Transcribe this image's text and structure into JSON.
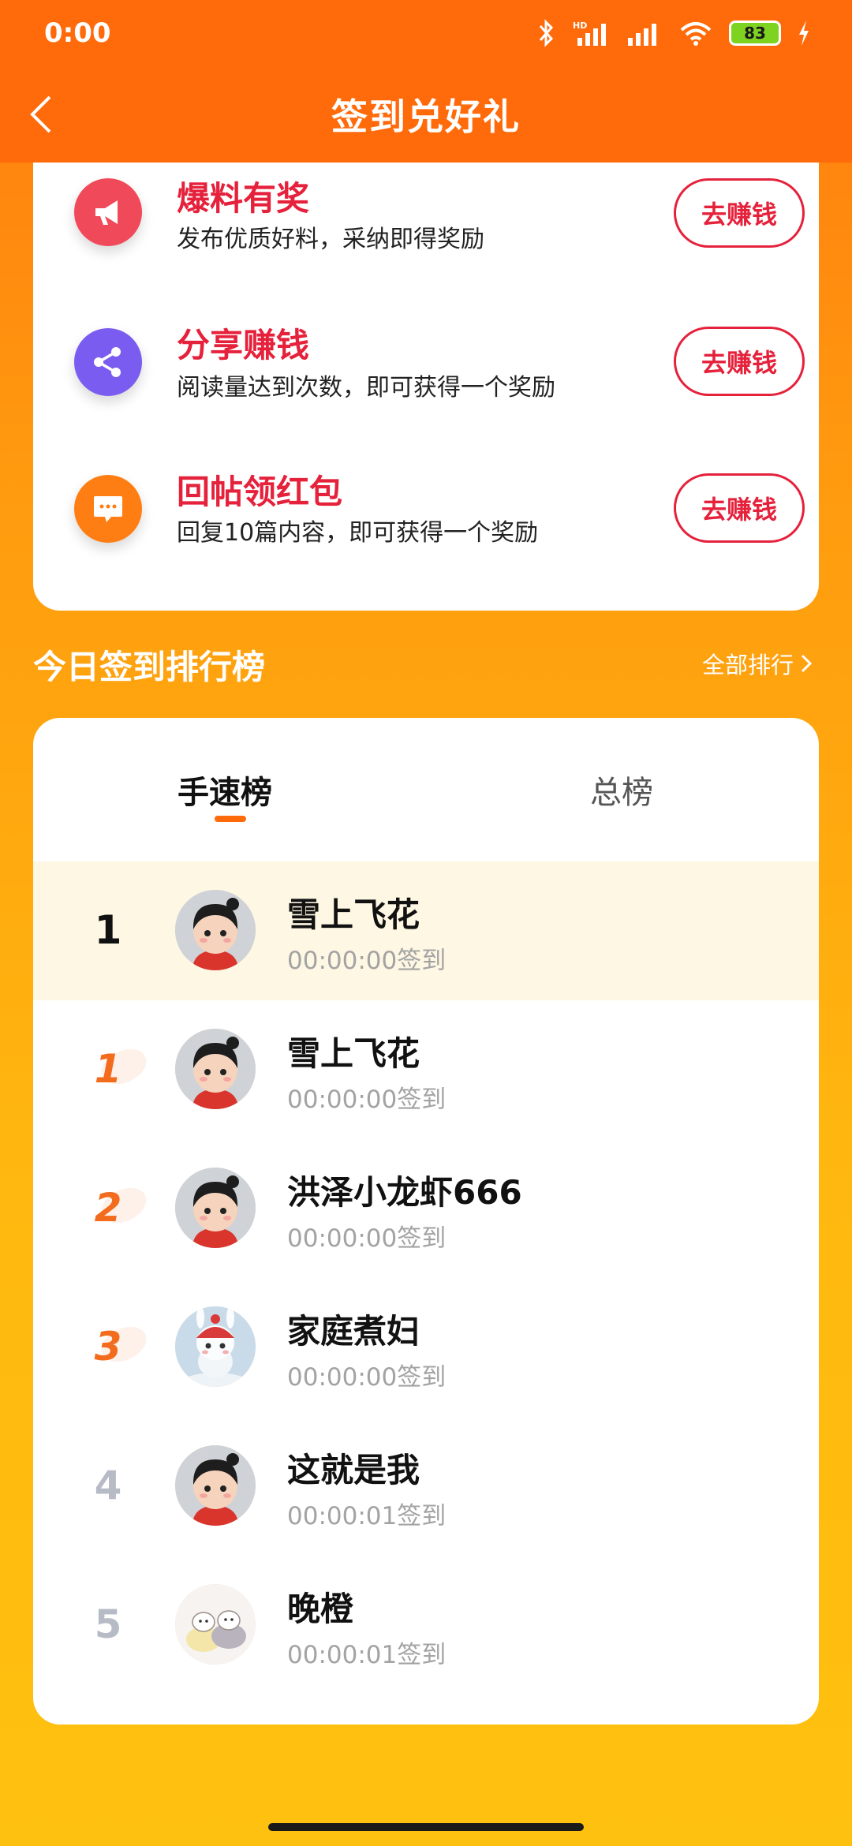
{
  "status_bar": {
    "time": "0:00",
    "battery": "83"
  },
  "header": {
    "title": "签到兑好礼"
  },
  "tasks": [
    {
      "title": "爆料有奖",
      "desc": "发布优质好料，采纳即得奖励",
      "button": "去赚钱",
      "icon": "megaphone-icon",
      "color": "#F04A5A"
    },
    {
      "title": "分享赚钱",
      "desc": "阅读量达到次数，即可获得一个奖励",
      "button": "去赚钱",
      "icon": "share-icon",
      "color": "#7B5CF0"
    },
    {
      "title": "回帖领红包",
      "desc": "回复10篇内容，即可获得一个奖励",
      "button": "去赚钱",
      "icon": "chat-bubble-icon",
      "color": "#FF7E14"
    }
  ],
  "ranking": {
    "section_title": "今日签到排行榜",
    "view_all": "全部排行",
    "tabs": [
      "手速榜",
      "总榜"
    ],
    "rows": [
      {
        "rank": "1",
        "name": "雪上飞花",
        "time": "00:00:00签到",
        "avatar": "cartoon-girl"
      },
      {
        "rank": "1",
        "name": "雪上飞花",
        "time": "00:00:00签到",
        "avatar": "cartoon-girl"
      },
      {
        "rank": "2",
        "name": "洪泽小龙虾666",
        "time": "00:00:00签到",
        "avatar": "cartoon-girl"
      },
      {
        "rank": "3",
        "name": "家庭煮妇",
        "time": "00:00:00签到",
        "avatar": "snow-bunny"
      },
      {
        "rank": "4",
        "name": "这就是我",
        "time": "00:00:01签到",
        "avatar": "cartoon-girl"
      },
      {
        "rank": "5",
        "name": "晚橙",
        "time": "00:00:01签到",
        "avatar": "doodle-cats"
      }
    ]
  }
}
